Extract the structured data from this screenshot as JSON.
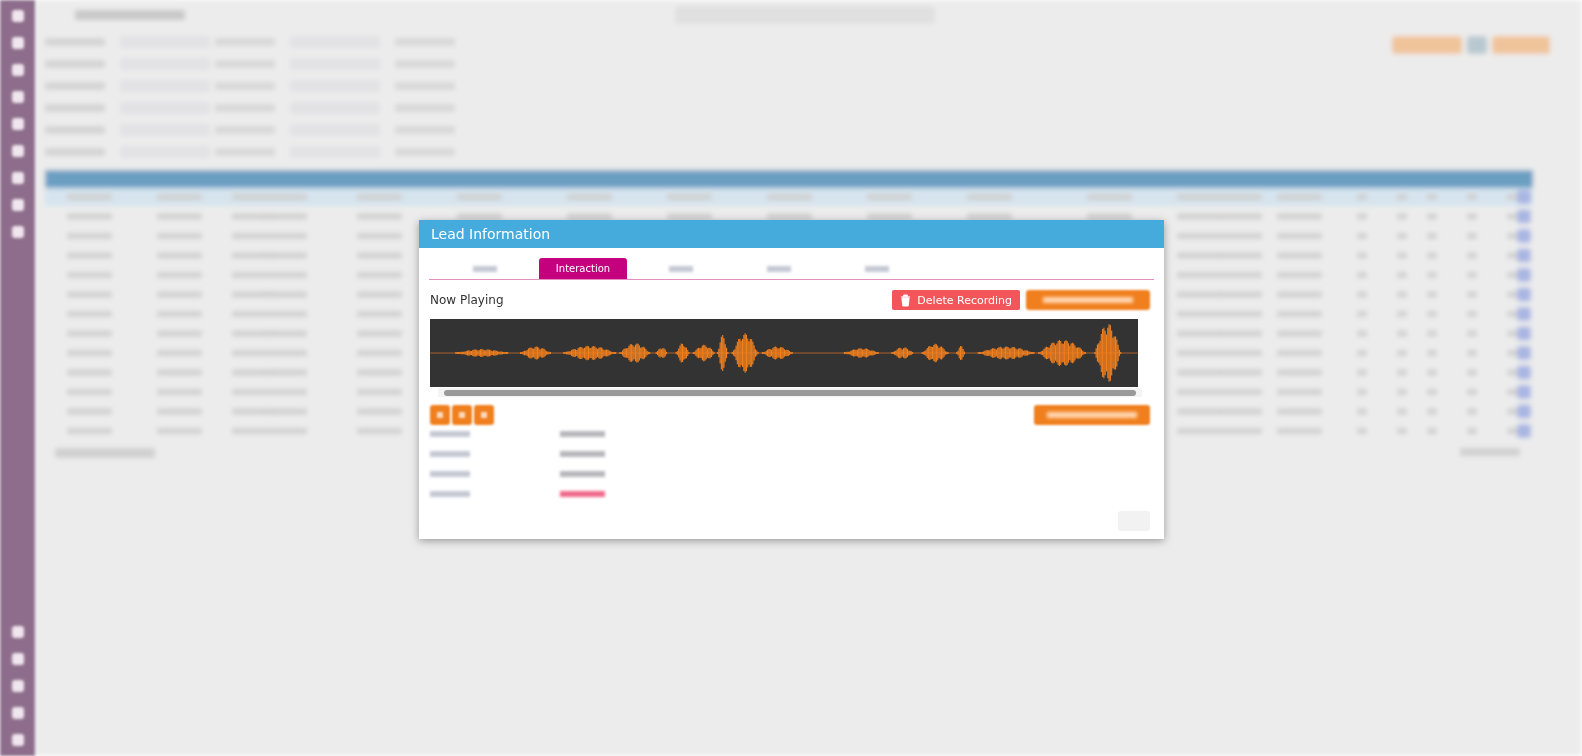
{
  "modal": {
    "title": "Lead Information",
    "tabs": [
      {
        "selected": false
      },
      {
        "label": "Interaction",
        "selected": true
      },
      {
        "selected": false
      },
      {
        "selected": false
      },
      {
        "selected": false
      }
    ],
    "now_playing": "Now Playing",
    "delete_button": "Delete Recording"
  }
}
